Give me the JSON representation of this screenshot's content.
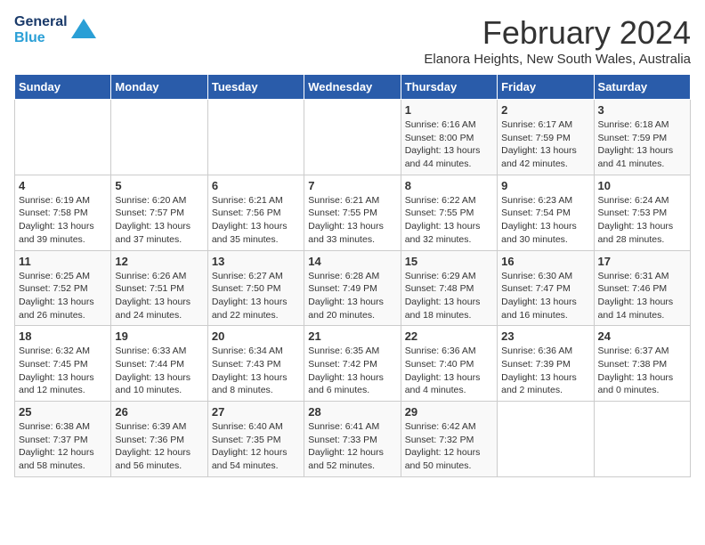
{
  "logo": {
    "general": "General",
    "blue": "Blue"
  },
  "title": "February 2024",
  "subtitle": "Elanora Heights, New South Wales, Australia",
  "days_of_week": [
    "Sunday",
    "Monday",
    "Tuesday",
    "Wednesday",
    "Thursday",
    "Friday",
    "Saturday"
  ],
  "weeks": [
    [
      {
        "num": "",
        "info": ""
      },
      {
        "num": "",
        "info": ""
      },
      {
        "num": "",
        "info": ""
      },
      {
        "num": "",
        "info": ""
      },
      {
        "num": "1",
        "info": "Sunrise: 6:16 AM\nSunset: 8:00 PM\nDaylight: 13 hours and 44 minutes."
      },
      {
        "num": "2",
        "info": "Sunrise: 6:17 AM\nSunset: 7:59 PM\nDaylight: 13 hours and 42 minutes."
      },
      {
        "num": "3",
        "info": "Sunrise: 6:18 AM\nSunset: 7:59 PM\nDaylight: 13 hours and 41 minutes."
      }
    ],
    [
      {
        "num": "4",
        "info": "Sunrise: 6:19 AM\nSunset: 7:58 PM\nDaylight: 13 hours and 39 minutes."
      },
      {
        "num": "5",
        "info": "Sunrise: 6:20 AM\nSunset: 7:57 PM\nDaylight: 13 hours and 37 minutes."
      },
      {
        "num": "6",
        "info": "Sunrise: 6:21 AM\nSunset: 7:56 PM\nDaylight: 13 hours and 35 minutes."
      },
      {
        "num": "7",
        "info": "Sunrise: 6:21 AM\nSunset: 7:55 PM\nDaylight: 13 hours and 33 minutes."
      },
      {
        "num": "8",
        "info": "Sunrise: 6:22 AM\nSunset: 7:55 PM\nDaylight: 13 hours and 32 minutes."
      },
      {
        "num": "9",
        "info": "Sunrise: 6:23 AM\nSunset: 7:54 PM\nDaylight: 13 hours and 30 minutes."
      },
      {
        "num": "10",
        "info": "Sunrise: 6:24 AM\nSunset: 7:53 PM\nDaylight: 13 hours and 28 minutes."
      }
    ],
    [
      {
        "num": "11",
        "info": "Sunrise: 6:25 AM\nSunset: 7:52 PM\nDaylight: 13 hours and 26 minutes."
      },
      {
        "num": "12",
        "info": "Sunrise: 6:26 AM\nSunset: 7:51 PM\nDaylight: 13 hours and 24 minutes."
      },
      {
        "num": "13",
        "info": "Sunrise: 6:27 AM\nSunset: 7:50 PM\nDaylight: 13 hours and 22 minutes."
      },
      {
        "num": "14",
        "info": "Sunrise: 6:28 AM\nSunset: 7:49 PM\nDaylight: 13 hours and 20 minutes."
      },
      {
        "num": "15",
        "info": "Sunrise: 6:29 AM\nSunset: 7:48 PM\nDaylight: 13 hours and 18 minutes."
      },
      {
        "num": "16",
        "info": "Sunrise: 6:30 AM\nSunset: 7:47 PM\nDaylight: 13 hours and 16 minutes."
      },
      {
        "num": "17",
        "info": "Sunrise: 6:31 AM\nSunset: 7:46 PM\nDaylight: 13 hours and 14 minutes."
      }
    ],
    [
      {
        "num": "18",
        "info": "Sunrise: 6:32 AM\nSunset: 7:45 PM\nDaylight: 13 hours and 12 minutes."
      },
      {
        "num": "19",
        "info": "Sunrise: 6:33 AM\nSunset: 7:44 PM\nDaylight: 13 hours and 10 minutes."
      },
      {
        "num": "20",
        "info": "Sunrise: 6:34 AM\nSunset: 7:43 PM\nDaylight: 13 hours and 8 minutes."
      },
      {
        "num": "21",
        "info": "Sunrise: 6:35 AM\nSunset: 7:42 PM\nDaylight: 13 hours and 6 minutes."
      },
      {
        "num": "22",
        "info": "Sunrise: 6:36 AM\nSunset: 7:40 PM\nDaylight: 13 hours and 4 minutes."
      },
      {
        "num": "23",
        "info": "Sunrise: 6:36 AM\nSunset: 7:39 PM\nDaylight: 13 hours and 2 minutes."
      },
      {
        "num": "24",
        "info": "Sunrise: 6:37 AM\nSunset: 7:38 PM\nDaylight: 13 hours and 0 minutes."
      }
    ],
    [
      {
        "num": "25",
        "info": "Sunrise: 6:38 AM\nSunset: 7:37 PM\nDaylight: 12 hours and 58 minutes."
      },
      {
        "num": "26",
        "info": "Sunrise: 6:39 AM\nSunset: 7:36 PM\nDaylight: 12 hours and 56 minutes."
      },
      {
        "num": "27",
        "info": "Sunrise: 6:40 AM\nSunset: 7:35 PM\nDaylight: 12 hours and 54 minutes."
      },
      {
        "num": "28",
        "info": "Sunrise: 6:41 AM\nSunset: 7:33 PM\nDaylight: 12 hours and 52 minutes."
      },
      {
        "num": "29",
        "info": "Sunrise: 6:42 AM\nSunset: 7:32 PM\nDaylight: 12 hours and 50 minutes."
      },
      {
        "num": "",
        "info": ""
      },
      {
        "num": "",
        "info": ""
      }
    ]
  ]
}
